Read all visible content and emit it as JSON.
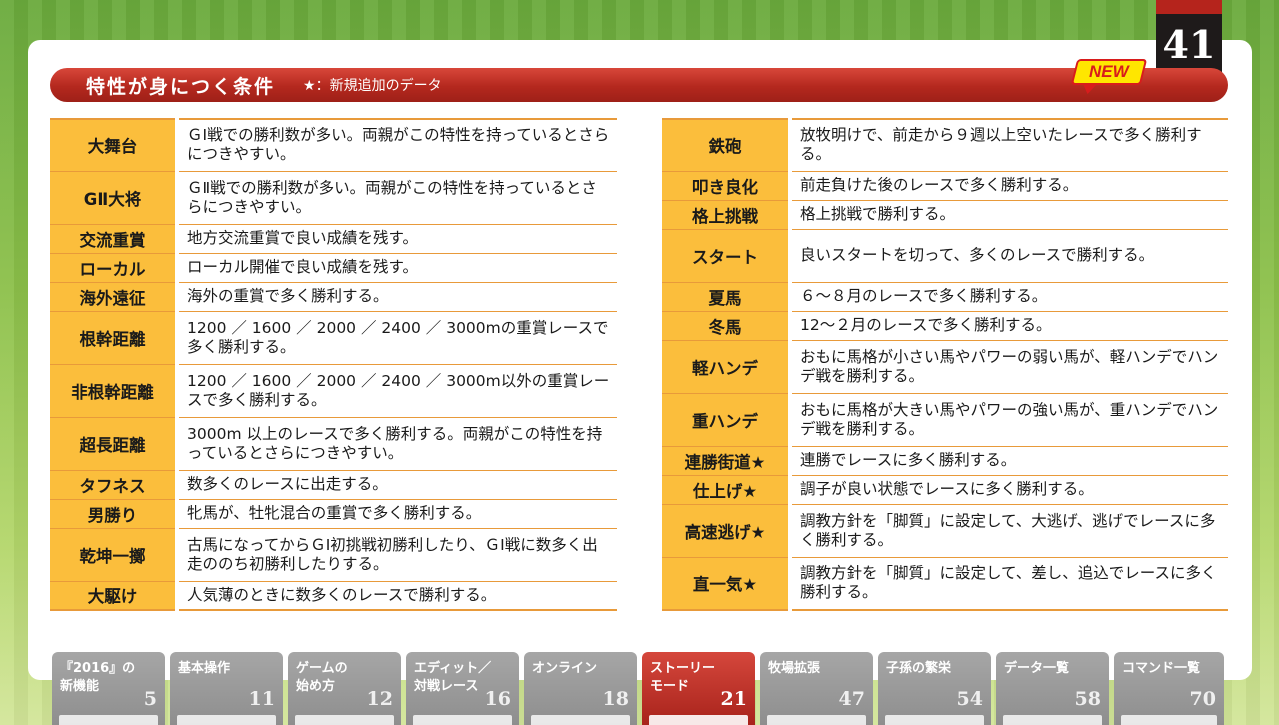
{
  "page": {
    "number": "41",
    "new_label": "NEW"
  },
  "header": {
    "title": "特性が身につく条件",
    "note": "★：新規追加のデータ"
  },
  "left_table": [
    {
      "name": "大舞台",
      "desc": "ＧⅠ戦での勝利数が多い。両親がこの特性を持っているとさらにつきやすい。"
    },
    {
      "name": "GⅡ大将",
      "desc": "ＧⅡ戦での勝利数が多い。両親がこの特性を持っているとさらにつきやすい。"
    },
    {
      "name": "交流重賞",
      "desc": "地方交流重賞で良い成績を残す。"
    },
    {
      "name": "ローカル",
      "desc": "ローカル開催で良い成績を残す。"
    },
    {
      "name": "海外遠征",
      "desc": "海外の重賞で多く勝利する。"
    },
    {
      "name": "根幹距離",
      "desc": "1200 ／ 1600 ／ 2000 ／ 2400 ／ 3000mの重賞レースで多く勝利する。"
    },
    {
      "name": "非根幹距離",
      "desc": "1200 ／ 1600 ／ 2000 ／ 2400 ／ 3000m以外の重賞レースで多く勝利する。"
    },
    {
      "name": "超長距離",
      "desc": "3000m 以上のレースで多く勝利する。両親がこの特性を持っているとさらにつきやすい。"
    },
    {
      "name": "タフネス",
      "desc": "数多くのレースに出走する。"
    },
    {
      "name": "男勝り",
      "desc": "牝馬が、牡牝混合の重賞で多く勝利する。"
    },
    {
      "name": "乾坤一擲",
      "desc": "古馬になってからＧⅠ初挑戦初勝利したり、ＧⅠ戦に数多く出走ののち初勝利したりする。"
    },
    {
      "name": "大駆け",
      "desc": "人気薄のときに数多くのレースで勝利する。"
    }
  ],
  "right_table": [
    {
      "name": "鉄砲",
      "desc": "放牧明けで、前走から９週以上空いたレースで多く勝利する。"
    },
    {
      "name": "叩き良化",
      "desc": "前走負けた後のレースで多く勝利する。"
    },
    {
      "name": "格上挑戦",
      "desc": "格上挑戦で勝利する。"
    },
    {
      "name": "スタート",
      "desc": "良いスタートを切って、多くのレースで勝利する。"
    },
    {
      "name": "夏馬",
      "desc": "６～８月のレースで多く勝利する。"
    },
    {
      "name": "冬馬",
      "desc": "12～２月のレースで多く勝利する。"
    },
    {
      "name": "軽ハンデ",
      "desc": "おもに馬格が小さい馬やパワーの弱い馬が、軽ハンデでハンデ戦を勝利する。"
    },
    {
      "name": "重ハンデ",
      "desc": "おもに馬格が大きい馬やパワーの強い馬が、重ハンデでハンデ戦を勝利する。"
    },
    {
      "name": "連勝街道★",
      "desc": "連勝でレースに多く勝利する。"
    },
    {
      "name": "仕上げ★",
      "desc": "調子が良い状態でレースに多く勝利する。"
    },
    {
      "name": "高速逃げ★",
      "desc": "調教方針を「脚質」に設定して、大逃げ、逃げでレースに多く勝利する。"
    },
    {
      "name": "直一気★",
      "desc": "調教方針を「脚質」に設定して、差し、追込でレースに多く勝利する。"
    }
  ],
  "nav_tabs": [
    {
      "label": "『2016』の\n新機能",
      "page": "5"
    },
    {
      "label": "基本操作",
      "page": "11"
    },
    {
      "label": "ゲームの\n始め方",
      "page": "12"
    },
    {
      "label": "エディット／\n対戦レース",
      "page": "16"
    },
    {
      "label": "オンライン",
      "page": "18"
    },
    {
      "label": "ストーリー\nモード",
      "page": "21",
      "active": true
    },
    {
      "label": "牧場拡張",
      "page": "47"
    },
    {
      "label": "子孫の繁栄",
      "page": "54"
    },
    {
      "label": "データ一覧",
      "page": "58"
    },
    {
      "label": "コマンド一覧",
      "page": "70"
    }
  ]
}
